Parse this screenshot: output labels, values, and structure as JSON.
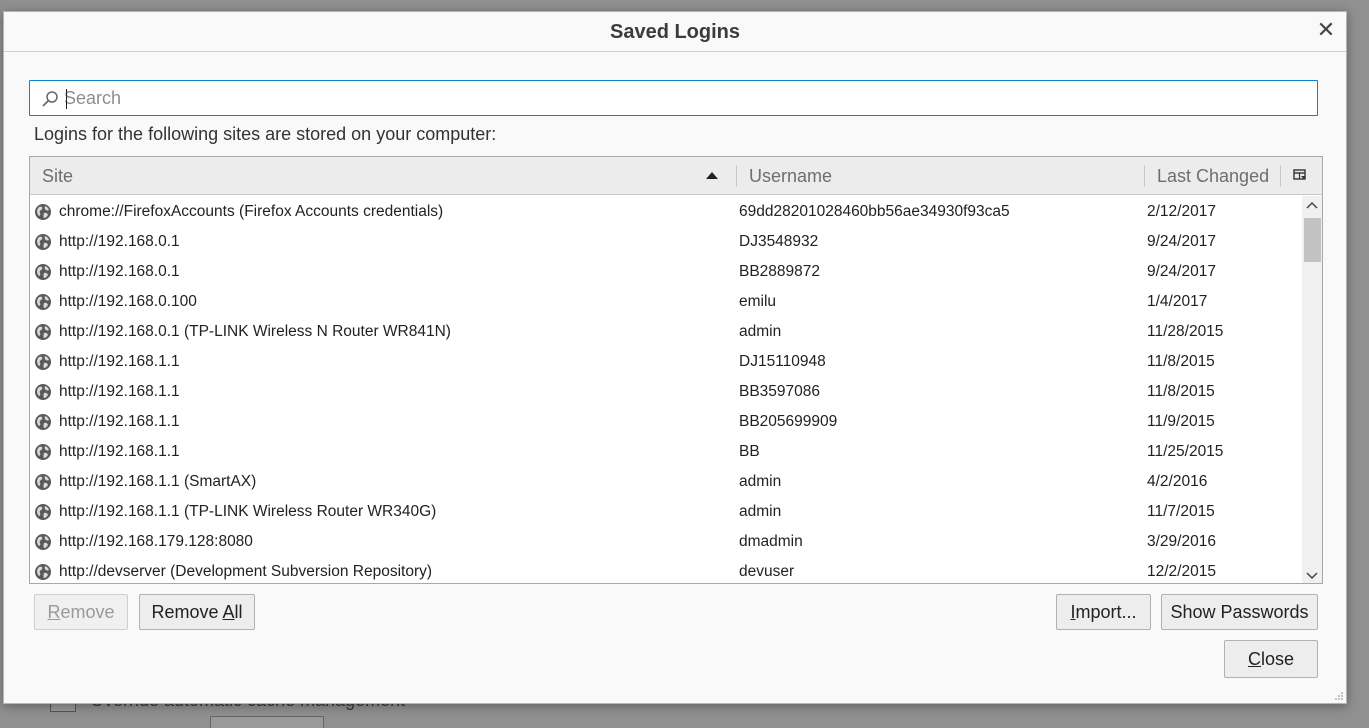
{
  "background": {
    "checkbox_label": "Override automatic cache management"
  },
  "dialog": {
    "title": "Saved Logins",
    "close_glyph": "✕"
  },
  "search": {
    "placeholder": "Search",
    "value": ""
  },
  "intro_text": "Logins for the following sites are stored on your computer:",
  "table": {
    "columns": {
      "site": "Site",
      "username": "Username",
      "last_changed": "Last Changed"
    },
    "sort": {
      "column": "site",
      "direction": "ascending"
    },
    "rows": [
      {
        "site": "chrome://FirefoxAccounts (Firefox Accounts credentials)",
        "username": "69dd28201028460bb56ae34930f93ca5",
        "last_changed": "2/12/2017"
      },
      {
        "site": "http://192.168.0.1",
        "username": "DJ3548932",
        "last_changed": "9/24/2017"
      },
      {
        "site": "http://192.168.0.1",
        "username": "BB2889872",
        "last_changed": "9/24/2017"
      },
      {
        "site": "http://192.168.0.100",
        "username": "emilu",
        "last_changed": "1/4/2017"
      },
      {
        "site": "http://192.168.0.1 (TP-LINK Wireless N Router WR841N)",
        "username": "admin",
        "last_changed": "11/28/2015"
      },
      {
        "site": "http://192.168.1.1",
        "username": "DJ15110948",
        "last_changed": "11/8/2015"
      },
      {
        "site": "http://192.168.1.1",
        "username": "BB3597086",
        "last_changed": "11/8/2015"
      },
      {
        "site": "http://192.168.1.1",
        "username": "BB205699909",
        "last_changed": "11/9/2015"
      },
      {
        "site": "http://192.168.1.1",
        "username": "BB",
        "last_changed": "11/25/2015"
      },
      {
        "site": "http://192.168.1.1 (SmartAX)",
        "username": "admin",
        "last_changed": "4/2/2016"
      },
      {
        "site": "http://192.168.1.1 (TP-LINK Wireless Router WR340G)",
        "username": "admin",
        "last_changed": "11/7/2015"
      },
      {
        "site": "http://192.168.179.128:8080",
        "username": "dmadmin",
        "last_changed": "3/29/2016"
      },
      {
        "site": "http://devserver (Development Subversion Repository)",
        "username": "devuser",
        "last_changed": "12/2/2015"
      }
    ]
  },
  "buttons": {
    "remove": {
      "mnemonic": "R",
      "rest": "emove",
      "enabled": false
    },
    "remove_all": {
      "before": "Remove ",
      "mnemonic": "A",
      "rest": "ll"
    },
    "import": {
      "mnemonic": "I",
      "rest": "mport..."
    },
    "show_passwords": {
      "label": "Show Passwords"
    },
    "close": {
      "mnemonic": "C",
      "rest": "lose"
    }
  },
  "icons": {
    "row_icon": "globe-icon",
    "search": "search-icon",
    "sort": "sort-ascending-icon",
    "column_picker": "column-picker-icon"
  }
}
